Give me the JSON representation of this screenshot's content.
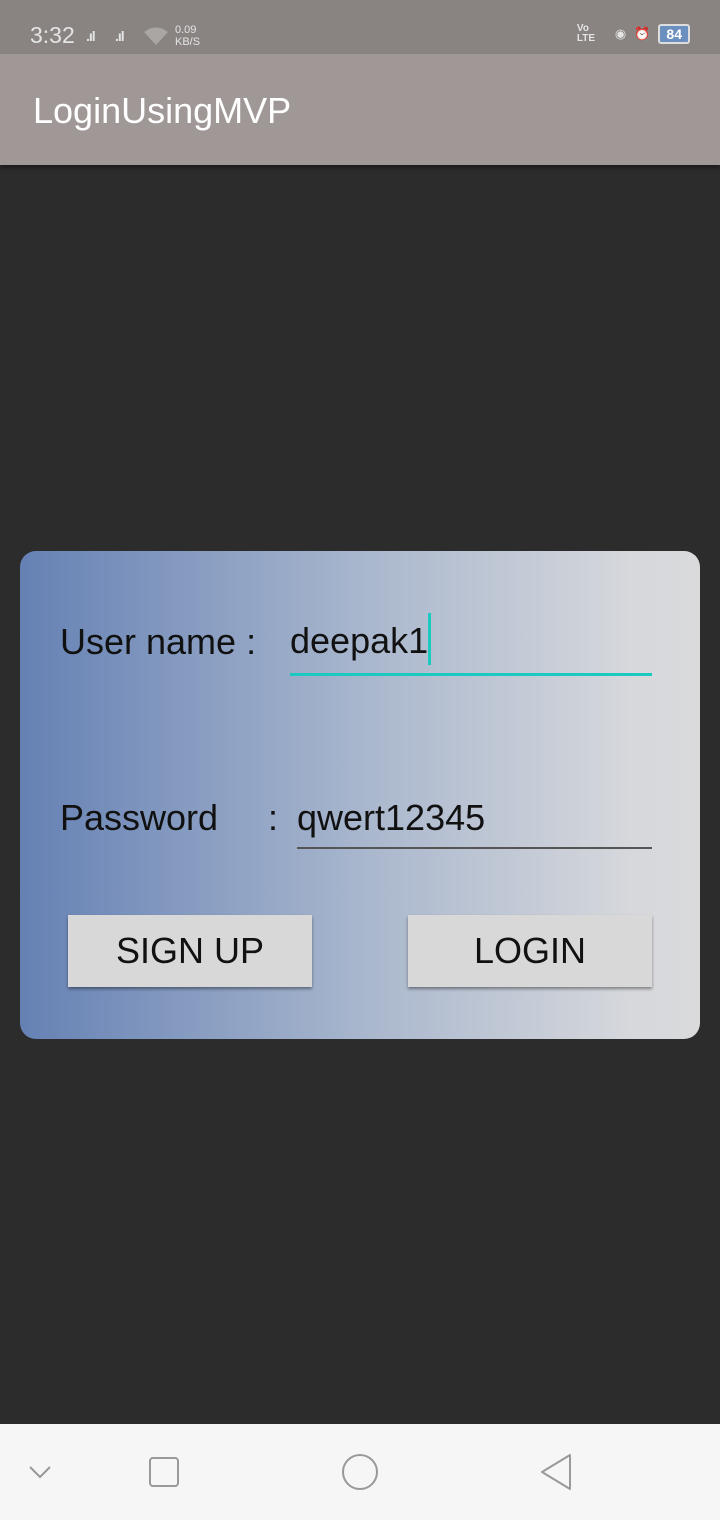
{
  "status": {
    "time": "3:32",
    "speed_value": "0.09",
    "speed_unit": "KB/S",
    "volte": "Vo LTE",
    "battery": "84"
  },
  "appbar": {
    "title": "LoginUsingMVP"
  },
  "form": {
    "username_label": "User name :",
    "username_value": "deepak1",
    "password_label": "Password",
    "password_colon": ":",
    "password_value": "qwert12345",
    "signup_label": "SIGN UP",
    "login_label": "LOGIN"
  },
  "colors": {
    "accent": "#1cc9c0",
    "card_start": "#6581b4",
    "card_end": "#dadadc"
  }
}
